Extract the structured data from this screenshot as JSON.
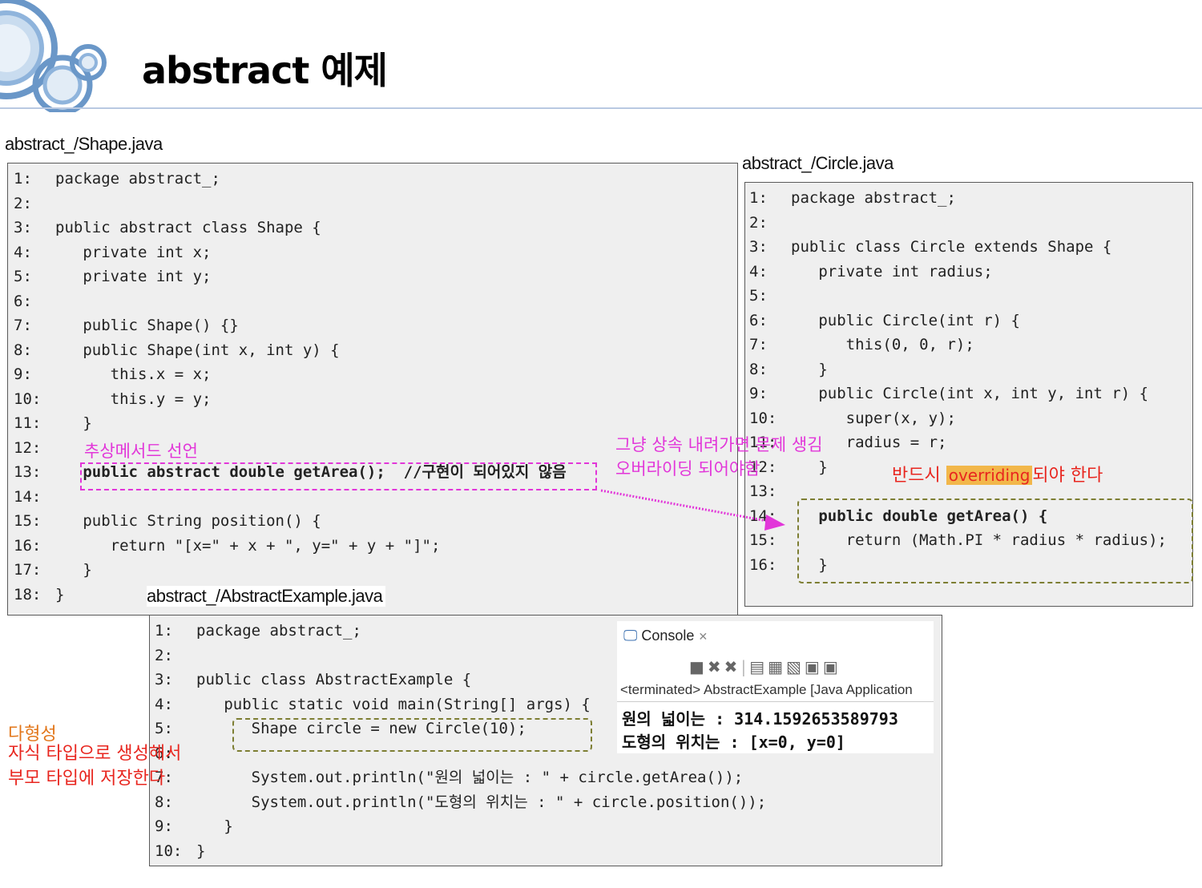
{
  "title": "abstract 예제",
  "shape_file": {
    "label": "abstract_/Shape.java",
    "lines": [
      {
        "n": "1:",
        "code": "package abstract_;"
      },
      {
        "n": "2:",
        "code": ""
      },
      {
        "n": "3:",
        "code": "public abstract class Shape {"
      },
      {
        "n": "4:",
        "code": "   private int x;"
      },
      {
        "n": "5:",
        "code": "   private int y;"
      },
      {
        "n": "6:",
        "code": ""
      },
      {
        "n": "7:",
        "code": "   public Shape() {}"
      },
      {
        "n": "8:",
        "code": "   public Shape(int x, int y) {"
      },
      {
        "n": "9:",
        "code": "      this.x = x;"
      },
      {
        "n": "10:",
        "code": "      this.y = y;"
      },
      {
        "n": "11:",
        "code": "   }"
      },
      {
        "n": "12:",
        "code": ""
      },
      {
        "n": "13:",
        "code": "   public abstract double getArea();  //구현이 되어있지 않음"
      },
      {
        "n": "14:",
        "code": ""
      },
      {
        "n": "15:",
        "code": "   public String position() {"
      },
      {
        "n": "16:",
        "code": "      return \"[x=\" + x + \", y=\" + y + \"]\";"
      },
      {
        "n": "17:",
        "code": "   }"
      },
      {
        "n": "18:",
        "code": "}"
      }
    ]
  },
  "circle_file": {
    "label": "abstract_/Circle.java",
    "lines": [
      {
        "n": "1:",
        "code": "package abstract_;"
      },
      {
        "n": "2:",
        "code": ""
      },
      {
        "n": "3:",
        "code": "public class Circle extends Shape {"
      },
      {
        "n": "4:",
        "code": "   private int radius;"
      },
      {
        "n": "5:",
        "code": ""
      },
      {
        "n": "6:",
        "code": "   public Circle(int r) {"
      },
      {
        "n": "7:",
        "code": "      this(0, 0, r);"
      },
      {
        "n": "8:",
        "code": "   }"
      },
      {
        "n": "9:",
        "code": "   public Circle(int x, int y, int r) {"
      },
      {
        "n": "10:",
        "code": "      super(x, y);"
      },
      {
        "n": "11:",
        "code": "      radius = r;"
      },
      {
        "n": "12:",
        "code": "   }"
      },
      {
        "n": "13:",
        "code": ""
      },
      {
        "n": "14:",
        "code": "   public double getArea() {"
      },
      {
        "n": "15:",
        "code": "      return (Math.PI * radius * radius);"
      },
      {
        "n": "16:",
        "code": "   }"
      }
    ]
  },
  "example_file": {
    "label": "abstract_/AbstractExample.java",
    "lines": [
      {
        "n": "1:",
        "code": "package abstract_;"
      },
      {
        "n": "2:",
        "code": ""
      },
      {
        "n": "3:",
        "code": "public class AbstractExample {"
      },
      {
        "n": "4:",
        "code": "   public static void main(String[] args) {"
      },
      {
        "n": "5:",
        "code": "      Shape circle = new Circle(10);"
      },
      {
        "n": "6:",
        "code": ""
      },
      {
        "n": "7:",
        "code": "      System.out.println(\"원의 넓이는 : \" + circle.getArea());"
      },
      {
        "n": "8:",
        "code": "      System.out.println(\"도형의 위치는 : \" + circle.position());"
      },
      {
        "n": "9:",
        "code": "   }"
      },
      {
        "n": "10:",
        "code": "}"
      }
    ]
  },
  "annotations": {
    "abstract_method": "추상메서드 선언",
    "inheritance_note_1": "그냥 상속 내려가면 문제 생김",
    "inheritance_note_2": "오버라이딩 되어야함",
    "must_prefix": "반드시",
    "must_highlight": "overriding",
    "must_suffix": "되야 한다",
    "poly_title": "다형성",
    "poly_line_1": "자식 타입으로 생성해서",
    "poly_line_2": "부모 타입에 저장한다"
  },
  "console": {
    "tab": "Console",
    "status": "<terminated> AbstractExample [Java Application",
    "output_1": "원의 넓이는 : 314.1592653589793",
    "output_2": "도형의 위치는 : [x=0, y=0]"
  },
  "colors": {
    "annotation_pink": "#e236d9",
    "annotation_red": "#e8261f",
    "annotation_orange": "#e2761a",
    "highlight": "#f2b74a",
    "code_bg": "#efefef"
  }
}
